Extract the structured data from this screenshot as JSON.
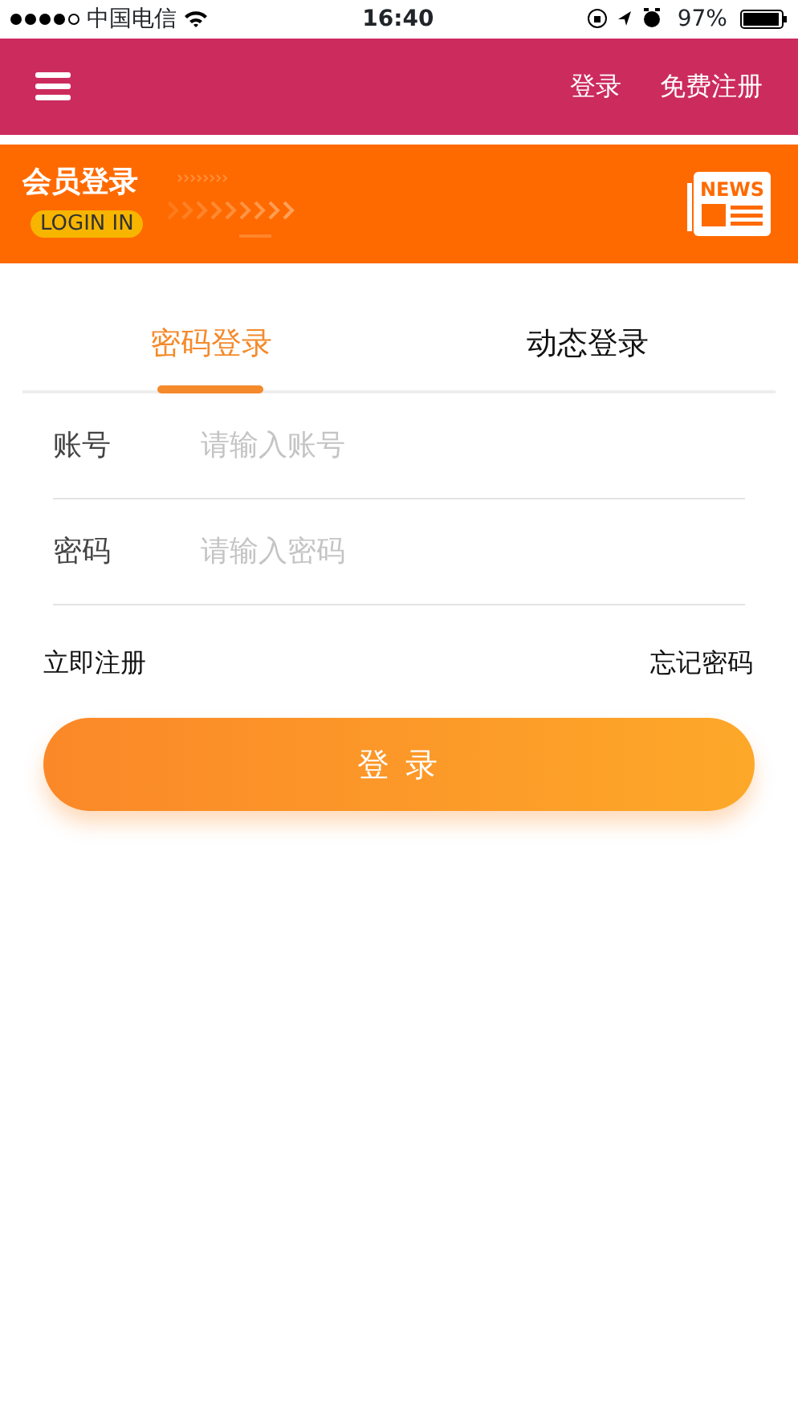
{
  "status_bar": {
    "carrier": "中国电信",
    "time": "16:40",
    "battery_percent": "97%"
  },
  "header": {
    "links": [
      "登录",
      "免费注册"
    ]
  },
  "banner": {
    "title": "会员登录",
    "badge": "LOGIN IN",
    "icon_text": "NEWS"
  },
  "tabs": [
    {
      "label": "密码登录",
      "selected": true
    },
    {
      "label": "动态登录",
      "selected": false
    }
  ],
  "fields": [
    {
      "label": "账号",
      "placeholder": "请输入账号"
    },
    {
      "label": "密码",
      "placeholder": "请输入密码"
    }
  ],
  "links": {
    "register": "立即注册",
    "forgot": "忘记密码"
  },
  "login_button": "登 录"
}
